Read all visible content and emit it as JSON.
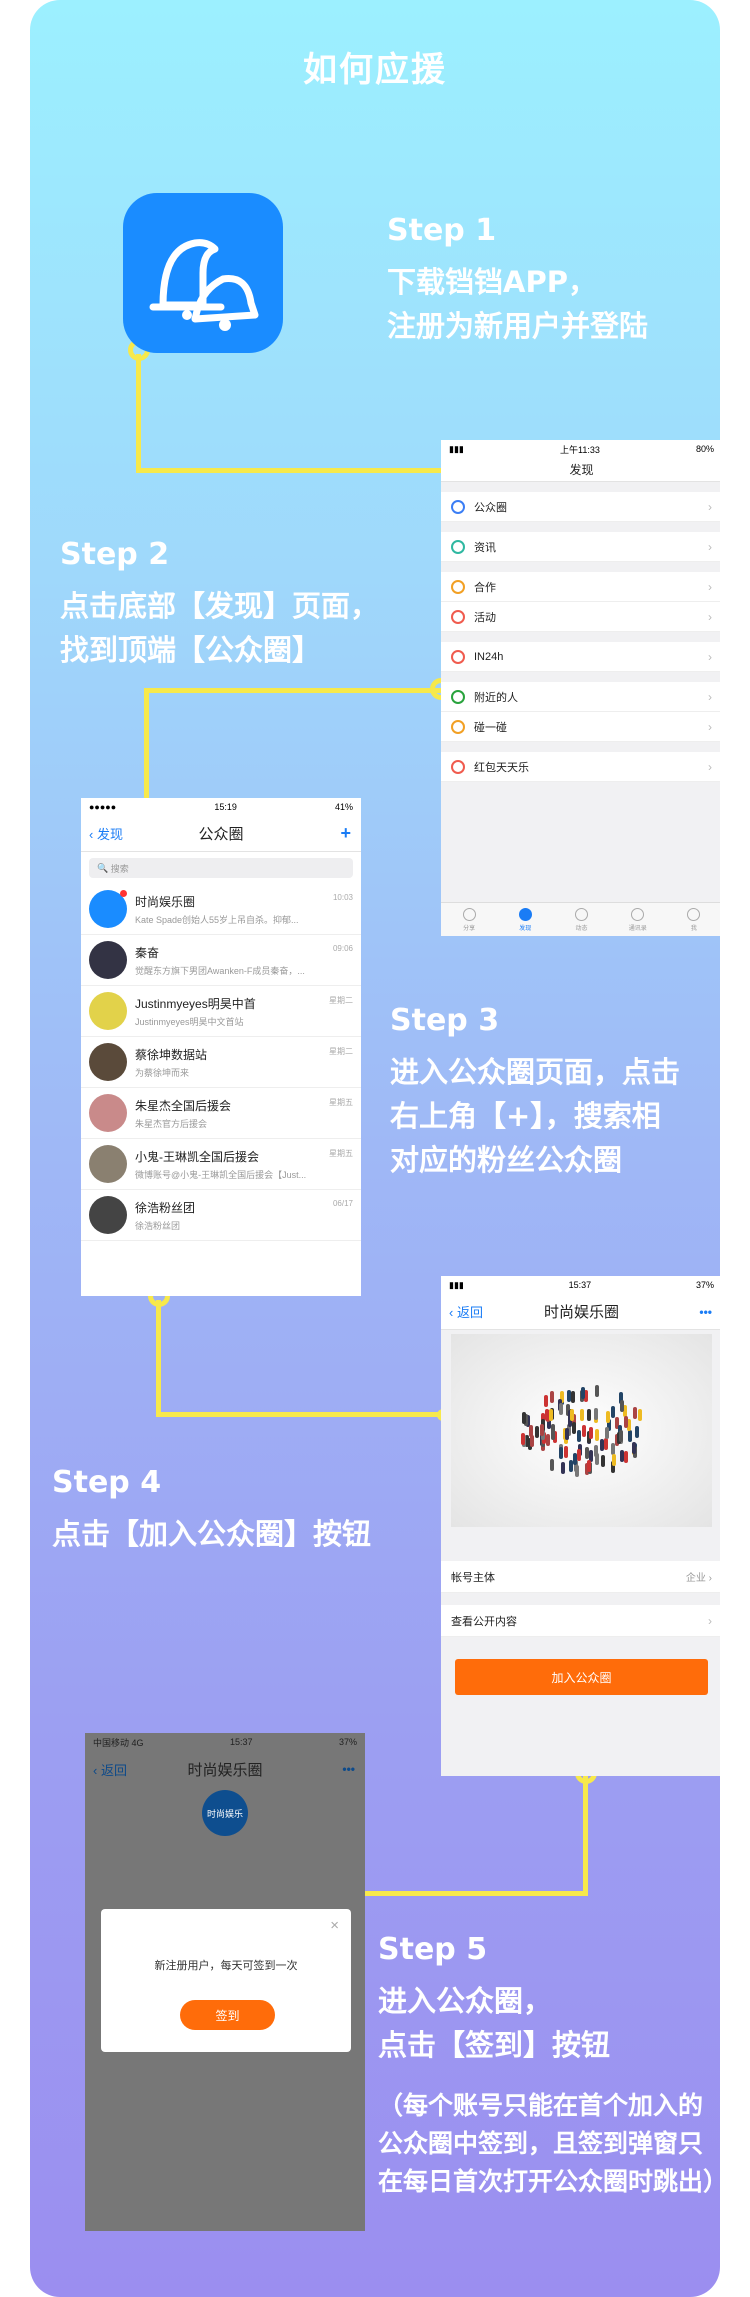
{
  "title": "如何应援",
  "colors": {
    "accent": "#f7e94b",
    "blue": "#1a8cff",
    "orange": "#ff6c0a"
  },
  "steps": [
    {
      "head": "Step 1",
      "lines": [
        "下载铛铛APP，",
        "注册为新用户并登陆"
      ]
    },
    {
      "head": "Step 2",
      "lines": [
        "点击底部【发现】页面，",
        "找到顶端【公众圈】"
      ]
    },
    {
      "head": "Step 3",
      "lines": [
        "进入公众圈页面，点击",
        "右上角【+】，搜索相",
        "对应的粉丝公众圈"
      ]
    },
    {
      "head": "Step 4",
      "lines": [
        "点击【加入公众圈】按钮"
      ]
    },
    {
      "head": "Step 5",
      "lines": [
        "进入公众圈，",
        "点击【签到】按钮"
      ],
      "note": [
        "（每个账号只能在首个加入的",
        "公众圈中签到，且签到弹窗只",
        "在每日首次打开公众圈时跳出）"
      ]
    }
  ],
  "discover": {
    "time": "上午11:33",
    "battery": "80%",
    "title": "发现",
    "groups": [
      [
        {
          "label": "公众圈",
          "icon": "circle-icon",
          "color": "#3b7ef5"
        }
      ],
      [
        {
          "label": "资讯",
          "icon": "news-icon",
          "color": "#2fb8a1"
        }
      ],
      [
        {
          "label": "合作",
          "icon": "cooperate-icon",
          "color": "#f2a024"
        },
        {
          "label": "活动",
          "icon": "activity-icon",
          "color": "#f05b4e"
        }
      ],
      [
        {
          "label": "IN24h",
          "icon": "clock-icon",
          "color": "#f05b4e"
        }
      ],
      [
        {
          "label": "附近的人",
          "icon": "location-icon",
          "color": "#29a33d"
        },
        {
          "label": "碰一碰",
          "icon": "bump-icon",
          "color": "#f2a024"
        }
      ],
      [
        {
          "label": "红包天天乐",
          "icon": "redpacket-icon",
          "color": "#f05b4e"
        }
      ]
    ],
    "tabs": [
      "分享",
      "发现",
      "动态",
      "通讯录",
      "我"
    ]
  },
  "circles": {
    "time": "15:19",
    "battery": "41%",
    "back": "发现",
    "title": "公众圈",
    "plus": "+",
    "search": "搜索",
    "items": [
      {
        "name": "时尚娱乐圈",
        "sub": "Kate Spade创始人55岁上吊自杀。抑郁...",
        "time": "10:03",
        "color": "#1a8cff",
        "badge": true
      },
      {
        "name": "秦奋",
        "sub": "觉醒东方旗下男团Awanken-F成员秦奋，...",
        "time": "09:06",
        "color": "#333344",
        "badge": false
      },
      {
        "name": "Justinmyeyes明昊中首",
        "sub": "Justinmyeyes明昊中文首站",
        "time": "星期二",
        "color": "#e2d24a",
        "badge": false
      },
      {
        "name": "蔡徐坤数据站",
        "sub": "为蔡徐坤而来",
        "time": "星期二",
        "color": "#5a4a3a",
        "badge": false
      },
      {
        "name": "朱星杰全国后援会",
        "sub": "朱星杰官方后援会",
        "time": "星期五",
        "color": "#c98a8a",
        "badge": false
      },
      {
        "name": "小鬼-王琳凯全国后援会",
        "sub": "微博账号@小鬼-王琳凯全国后援会【Just...",
        "time": "星期五",
        "color": "#8a8070",
        "badge": false
      },
      {
        "name": "徐浩粉丝团",
        "sub": "徐浩粉丝团",
        "time": "06/17",
        "color": "#444444",
        "badge": false
      }
    ]
  },
  "detail": {
    "time": "15:37",
    "battery": "37%",
    "back": "返回",
    "title": "时尚娱乐圈",
    "more": "•••",
    "rows": [
      {
        "label": "帐号主体",
        "value": "企业"
      },
      {
        "label": "查看公开内容",
        "value": ""
      }
    ],
    "join": "加入公众圈"
  },
  "signin": {
    "carrier": "中国移动 4G",
    "time": "15:37",
    "battery": "37%",
    "back": "返回",
    "title": "时尚娱乐圈",
    "more": "•••",
    "avatar_text": "时尚娱乐",
    "message": "新注册用户，每天可签到一次",
    "button": "签到",
    "close": "×"
  }
}
